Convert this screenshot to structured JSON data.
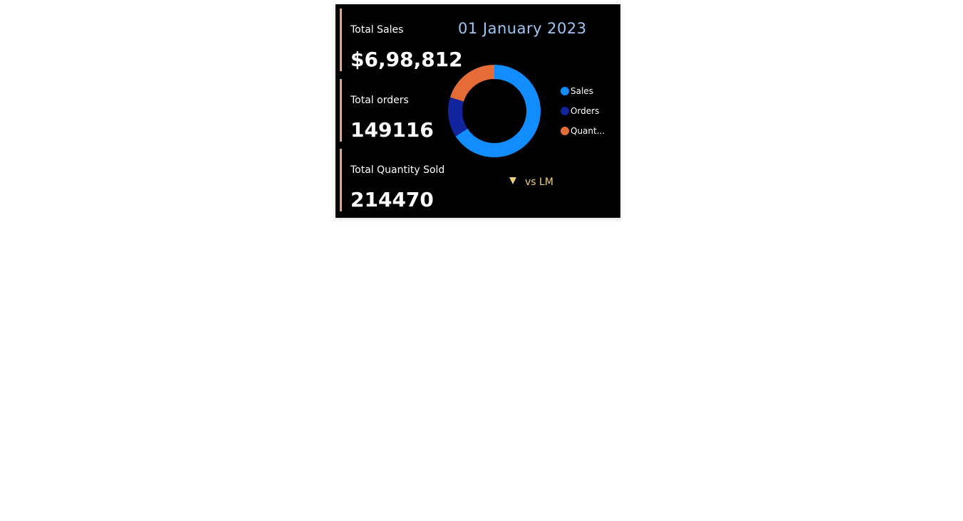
{
  "kpis": [
    {
      "label": "Total Sales",
      "value": "$6,98,812"
    },
    {
      "label": "Total orders",
      "value": "149116"
    },
    {
      "label": "Total Quantity Sold",
      "value": "214470"
    }
  ],
  "date": "01 January 2023",
  "legend": [
    {
      "label": "Sales",
      "color": "#118dff"
    },
    {
      "label": "Orders",
      "color": "#12239e"
    },
    {
      "label": "Quant...",
      "color": "#e66c37"
    }
  ],
  "comparison": {
    "label": "vs LM",
    "indicator_icon": "down-triangle-icon",
    "color": "#ecd079"
  },
  "chart_data": {
    "type": "pie",
    "variant": "donut",
    "categories": [
      "Sales",
      "Orders",
      "Quantity"
    ],
    "values": [
      698812,
      149116,
      214470
    ],
    "colors": [
      "#118dff",
      "#12239e",
      "#e66c37"
    ],
    "legend_position": "right"
  }
}
